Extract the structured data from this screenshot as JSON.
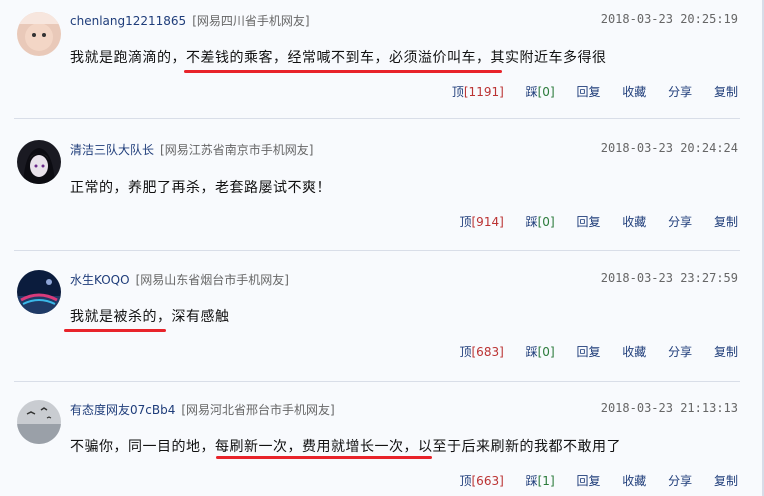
{
  "comments": [
    {
      "user": "chenlang12211865",
      "location": "[网易四川省手机网友]",
      "time": "2018-03-23 20:25:19",
      "text": "我就是跑滴滴的，不差钱的乘客，经常喊不到车，必须溢价叫车，其实附近车多得很",
      "up": "[1191]",
      "down": "[0]"
    },
    {
      "user": "清洁三队大队长",
      "location": "[网易江苏省南京市手机网友]",
      "time": "2018-03-23 20:24:24",
      "text": "正常的，养肥了再杀，老套路屡试不爽！",
      "up": "[914]",
      "down": "[0]"
    },
    {
      "user": "水生KOQO",
      "location": "[网易山东省烟台市手机网友]",
      "time": "2018-03-23 23:27:59",
      "text": "我就是被杀的，深有感触",
      "up": "[683]",
      "down": "[0]"
    },
    {
      "user": "有态度网友07cBb4",
      "location": "[网易河北省邢台市手机网友]",
      "time": "2018-03-23 21:13:13",
      "text": "不骗你，同一目的地，每刷新一次，费用就增长一次，以至于后来刷新的我都不敢用了",
      "up": "[663]",
      "down": "[1]"
    }
  ],
  "labels": {
    "up": "顶",
    "down": "踩",
    "reply": "回复",
    "favorite": "收藏",
    "share": "分享",
    "copy": "复制"
  },
  "colors": {
    "highlight": "#e8232a",
    "link": "#1f3d7a",
    "background": "#f8fafd"
  },
  "avatars": [
    "baby-photo-avatar",
    "anime-character-avatar",
    "landscape-avatar",
    "birds-avatar"
  ]
}
